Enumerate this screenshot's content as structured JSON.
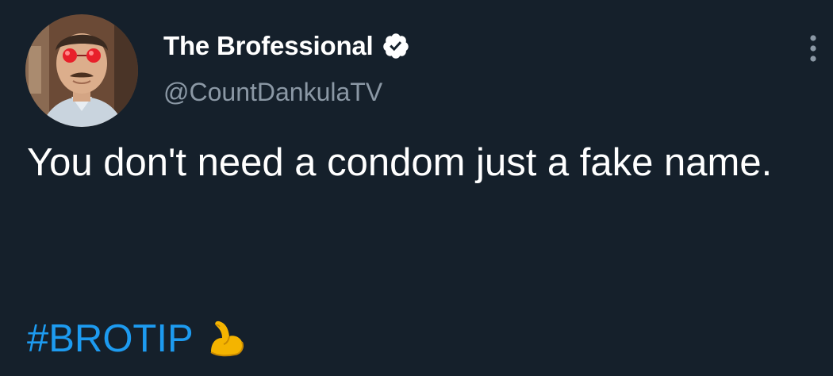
{
  "author": {
    "display_name": "The Brofessional",
    "handle": "@CountDankulaTV",
    "verified": true,
    "avatar_icon": "profile-photo-red-glasses"
  },
  "tweet": {
    "text": "You don't need a condom just a fake name.",
    "hashtag": "#BROTIP",
    "emoji": "flexed-biceps"
  },
  "menu_icon": "more-vertical-icon",
  "colors": {
    "background": "#15202b",
    "text": "#ffffff",
    "secondary_text": "#8b98a5",
    "link": "#1d9bf0"
  }
}
